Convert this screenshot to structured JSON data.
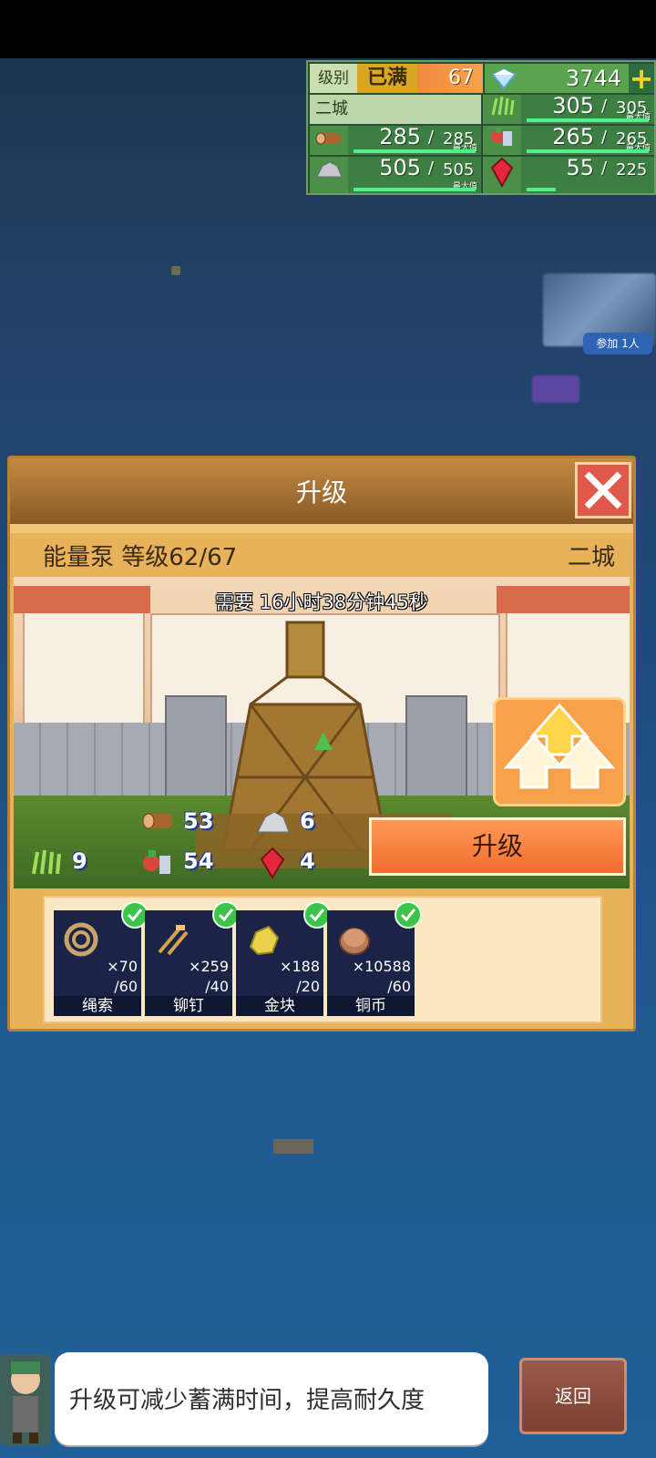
{
  "hud": {
    "level_label": "级别",
    "level_status": "已满",
    "level_value": "67",
    "gems": "3744",
    "city": "二城",
    "max_label": "最大值",
    "resources": [
      {
        "icon": "grass-icon",
        "current": "305",
        "max": "305",
        "fill": 1.0
      },
      {
        "icon": "wood-icon",
        "current": "285",
        "max": "285",
        "fill": 1.0
      },
      {
        "icon": "food-icon",
        "current": "265",
        "max": "265",
        "fill": 1.0
      },
      {
        "icon": "ore-icon",
        "current": "505",
        "max": "505",
        "fill": 1.0
      },
      {
        "icon": "ruby-icon",
        "current": "55",
        "max": "225",
        "fill": 0.24
      }
    ]
  },
  "side": {
    "join_label": "参加 1人"
  },
  "dialog": {
    "title": "升级",
    "building": "能量泵 等级62/67",
    "city": "二城",
    "timer": "需要 16小时38分钟45秒",
    "upgrade_label": "升级",
    "costs": [
      {
        "icon": "wood-icon",
        "value": "53"
      },
      {
        "icon": "ore-icon",
        "value": "6"
      },
      {
        "icon": "grass-icon",
        "value": "9"
      },
      {
        "icon": "food-icon",
        "value": "54"
      },
      {
        "icon": "ruby-icon",
        "value": "4"
      }
    ],
    "materials": [
      {
        "name": "绳索",
        "count": "×70",
        "required": "/60",
        "icon": "rope-icon"
      },
      {
        "name": "铆钉",
        "count": "×259",
        "required": "/40",
        "icon": "rivet-icon"
      },
      {
        "name": "金块",
        "count": "×188",
        "required": "/20",
        "icon": "gold-nugget-icon"
      },
      {
        "name": "铜币",
        "count": "×10588",
        "required": "/60",
        "icon": "copper-coin-icon"
      }
    ]
  },
  "hint": "升级可减少蓄满时间，提高耐久度",
  "back_label": "返回"
}
